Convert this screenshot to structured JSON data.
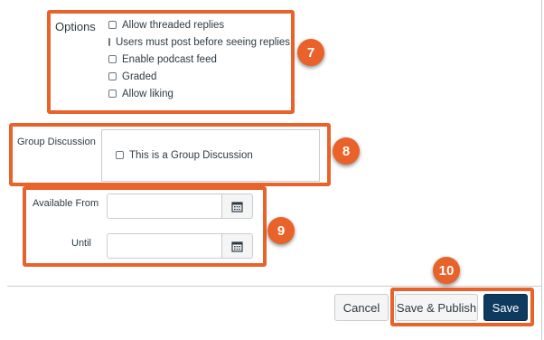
{
  "options": {
    "heading": "Options",
    "items": [
      {
        "label": "Allow threaded replies",
        "checked": false
      },
      {
        "label": "Users must post before seeing replies",
        "checked": false
      },
      {
        "label": "Enable podcast feed",
        "checked": false
      },
      {
        "label": "Graded",
        "checked": false
      },
      {
        "label": "Allow liking",
        "checked": false
      }
    ]
  },
  "group": {
    "heading": "Group Discussion",
    "checkbox_label": "This is a Group Discussion",
    "checked": false
  },
  "availability": {
    "from_label": "Available From",
    "from_value": "",
    "until_label": "Until",
    "until_value": ""
  },
  "footer": {
    "cancel_label": "Cancel",
    "save_publish_label": "Save & Publish",
    "save_label": "Save"
  },
  "callouts": {
    "options": "7",
    "group": "8",
    "dates": "9",
    "buttons": "10"
  },
  "colors": {
    "highlight": "#e8622a",
    "primary_button": "#0e3a60",
    "text": "#2d3b45"
  }
}
